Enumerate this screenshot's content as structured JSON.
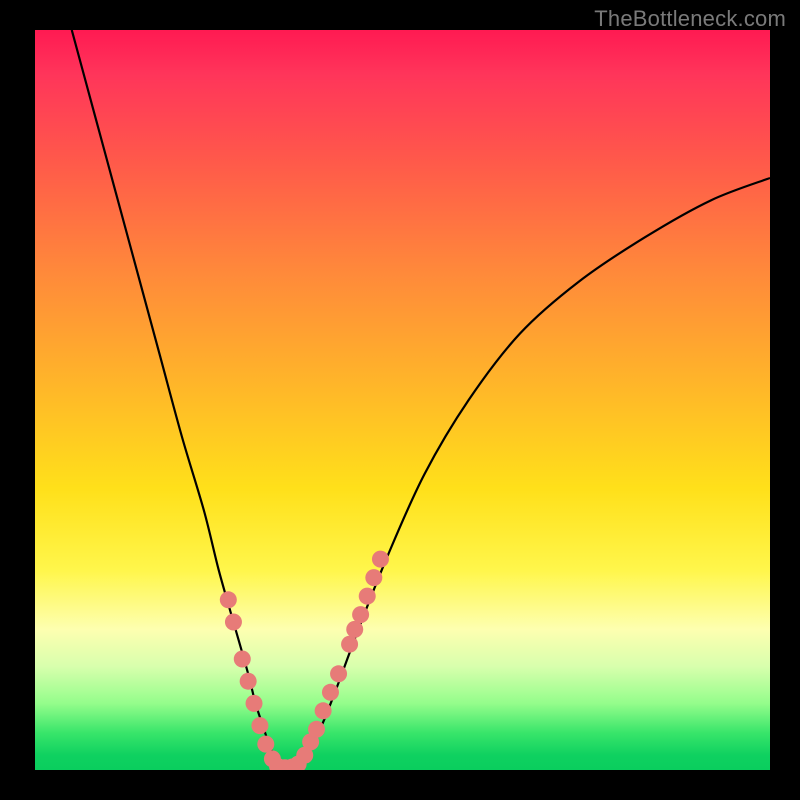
{
  "watermark": "TheBottleneck.com",
  "colors": {
    "background": "#000000",
    "curve": "#000000",
    "dots": "#e77b78"
  },
  "chart_data": {
    "type": "line",
    "title": "",
    "xlabel": "",
    "ylabel": "",
    "xlim": [
      0,
      100
    ],
    "ylim": [
      0,
      100
    ],
    "grid": false,
    "series": [
      {
        "name": "bottleneck-curve",
        "x": [
          5,
          8,
          11,
          14,
          17,
          20,
          23,
          25,
          27,
          29,
          30,
          31,
          32,
          33,
          34,
          35,
          37,
          39,
          41,
          44,
          48,
          53,
          59,
          66,
          74,
          83,
          92,
          100
        ],
        "y": [
          100,
          89,
          78,
          67,
          56,
          45,
          35,
          27,
          20,
          13,
          9,
          6,
          3,
          1,
          0,
          0,
          2,
          6,
          11,
          19,
          29,
          40,
          50,
          59,
          66,
          72,
          77,
          80
        ]
      }
    ],
    "annotations": {
      "dots_left": [
        {
          "x": 26.3,
          "y": 23
        },
        {
          "x": 27.0,
          "y": 20
        },
        {
          "x": 28.2,
          "y": 15
        },
        {
          "x": 29.0,
          "y": 12
        },
        {
          "x": 29.8,
          "y": 9
        },
        {
          "x": 30.6,
          "y": 6
        },
        {
          "x": 31.4,
          "y": 3.5
        },
        {
          "x": 32.3,
          "y": 1.5
        }
      ],
      "dots_bottom": [
        {
          "x": 33.0,
          "y": 0.5
        },
        {
          "x": 34.0,
          "y": 0.3
        },
        {
          "x": 35.0,
          "y": 0.4
        },
        {
          "x": 35.8,
          "y": 0.8
        }
      ],
      "dots_right": [
        {
          "x": 36.7,
          "y": 2
        },
        {
          "x": 37.5,
          "y": 3.8
        },
        {
          "x": 38.3,
          "y": 5.5
        },
        {
          "x": 39.2,
          "y": 8
        },
        {
          "x": 40.2,
          "y": 10.5
        },
        {
          "x": 41.3,
          "y": 13
        },
        {
          "x": 42.8,
          "y": 17
        },
        {
          "x": 43.5,
          "y": 19
        },
        {
          "x": 44.3,
          "y": 21
        },
        {
          "x": 45.2,
          "y": 23.5
        },
        {
          "x": 46.1,
          "y": 26
        },
        {
          "x": 47.0,
          "y": 28.5
        }
      ]
    }
  }
}
